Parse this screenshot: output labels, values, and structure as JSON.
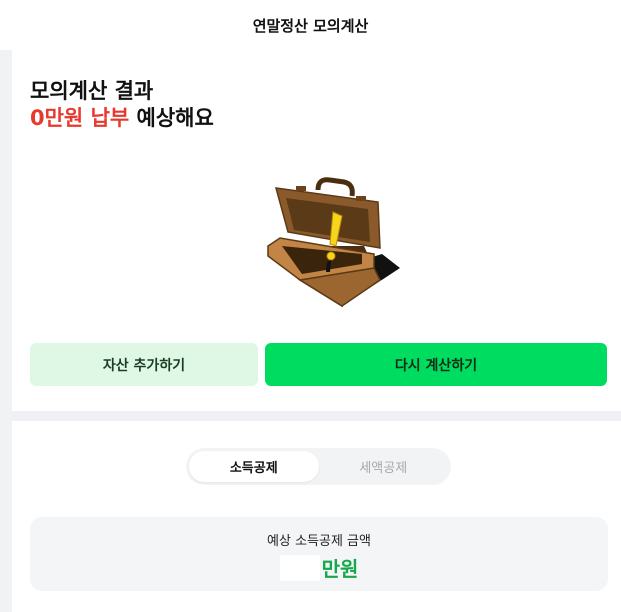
{
  "header": {
    "title": "연말정산 모의계산"
  },
  "result": {
    "title": "모의계산 결과",
    "amount": "0만원 납부",
    "suffix": "예상해요"
  },
  "illustration": {
    "name": "open-briefcase-exclamation-icon"
  },
  "buttons": {
    "add_assets": "자산 추가하기",
    "recalculate": "다시 계산하기"
  },
  "tabs": [
    {
      "label": "소득공제",
      "active": true
    },
    {
      "label": "세액공제",
      "active": false
    }
  ],
  "summary": {
    "label": "예상 소득공제 금액",
    "unit": "만원"
  },
  "colors": {
    "accent_green": "#00dc5f",
    "light_green": "#dff8e5",
    "amount_red": "#e8392f",
    "value_green": "#17a84c"
  }
}
